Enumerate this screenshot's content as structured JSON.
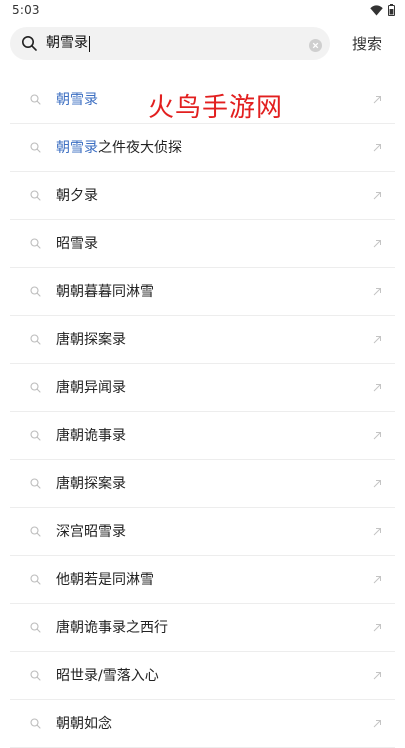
{
  "status_bar": {
    "time": "5:03",
    "icons": [
      "wifi-icon",
      "battery-icon"
    ]
  },
  "search": {
    "query": "朝雪录",
    "submit_label": "搜索",
    "icon": "search-icon",
    "clear_icon": "clear-icon"
  },
  "watermark": "火鸟手游网",
  "colors": {
    "highlight": "#3d6fc2",
    "watermark": "#e21f1f",
    "divider": "#ededed",
    "search_bg": "#f2f2f2"
  },
  "suggestions": [
    {
      "highlight": "朝雪录",
      "rest": ""
    },
    {
      "highlight": "朝雪录",
      "rest": "之件夜大侦探"
    },
    {
      "highlight": "",
      "rest": "朝夕录"
    },
    {
      "highlight": "",
      "rest": "昭雪录"
    },
    {
      "highlight": "",
      "rest": "朝朝暮暮同淋雪"
    },
    {
      "highlight": "",
      "rest": "唐朝探案录"
    },
    {
      "highlight": "",
      "rest": "唐朝异闻录"
    },
    {
      "highlight": "",
      "rest": "唐朝诡事录"
    },
    {
      "highlight": "",
      "rest": "唐朝探案录"
    },
    {
      "highlight": "",
      "rest": "深宫昭雪录"
    },
    {
      "highlight": "",
      "rest": "他朝若是同淋雪"
    },
    {
      "highlight": "",
      "rest": "唐朝诡事录之西行"
    },
    {
      "highlight": "",
      "rest": "昭世录/雪落入心"
    },
    {
      "highlight": "",
      "rest": "朝朝如念"
    }
  ],
  "suggestion_icons": {
    "left": "search-icon",
    "right": "fill-arrow-icon"
  }
}
